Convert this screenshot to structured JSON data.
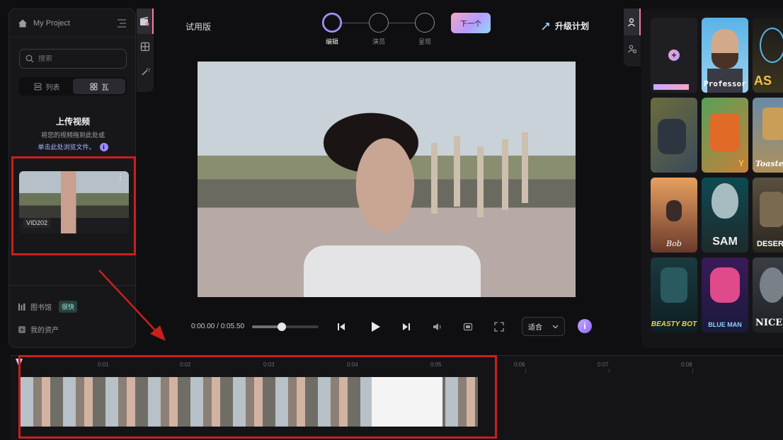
{
  "project": {
    "title": "My Project"
  },
  "left_panel": {
    "search_placeholder": "搜索",
    "view_toggle": {
      "list": "列表",
      "grid": "瓦"
    },
    "upload": {
      "heading": "上传视频",
      "line1": "将您的视频拖到此处或",
      "line2": "单击此处浏览文件。"
    },
    "clip": {
      "name": "VID202"
    },
    "links": [
      {
        "label": "图书馆",
        "badge": "很快"
      },
      {
        "label": "我的资产"
      }
    ]
  },
  "header": {
    "trial": "试用版",
    "steps": [
      {
        "label": "编辑",
        "active": true
      },
      {
        "label": "演员",
        "active": false
      },
      {
        "label": "呈现",
        "active": false
      }
    ],
    "next_button": "下一个",
    "upgrade": "升级计划"
  },
  "player": {
    "time": "0:00.00 / 0:05.50",
    "progress": 0.45,
    "fit_option": "适合",
    "info": "i"
  },
  "avatars": [
    {
      "name": ""
    },
    {
      "name": "Professor"
    },
    {
      "name": "AS"
    },
    {
      "name": ""
    },
    {
      "name": "Y"
    },
    {
      "name": "Toaster"
    },
    {
      "name": "Bob"
    },
    {
      "name": "SAM"
    },
    {
      "name": "DESERTE"
    },
    {
      "name": "BEASTY BOT"
    },
    {
      "name": "BLUE MAN"
    },
    {
      "name": "NICE B"
    }
  ],
  "timeline": {
    "ticks": [
      "0:01",
      "0:02",
      "0:03",
      "0:04",
      "0:05",
      "0:06",
      "0:07",
      "0:08"
    ]
  },
  "colors": {
    "accent_pink": "#f6a5c6",
    "accent_purple": "#b59cff",
    "highlight_red": "#c8201c"
  }
}
